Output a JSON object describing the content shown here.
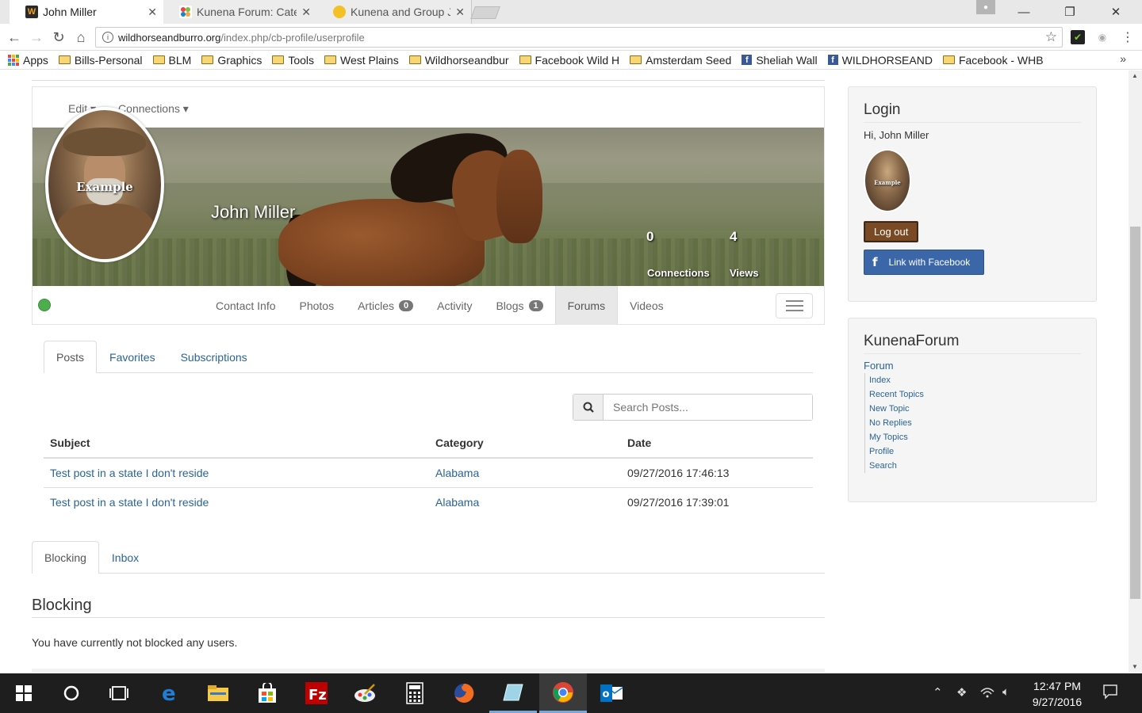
{
  "browser": {
    "tabs": [
      {
        "title": "John Miller",
        "favicon": "W",
        "favicon_bg": "#2a2a2a",
        "favicon_fg": "#f0a020",
        "active": true
      },
      {
        "title": "Kunena Forum: Cate",
        "favicon": "joomla-icon",
        "active": false
      },
      {
        "title": "Kunena and Group J",
        "favicon": "kunena-icon",
        "active": false
      }
    ],
    "url_host": "wildhorseandburro.org",
    "url_path": "/index.php/cb-profile/userprofile",
    "bookmarks": [
      {
        "label": "Apps",
        "type": "apps"
      },
      {
        "label": "Bills-Personal",
        "type": "folder"
      },
      {
        "label": "BLM",
        "type": "folder"
      },
      {
        "label": "Graphics",
        "type": "folder"
      },
      {
        "label": "Tools",
        "type": "folder"
      },
      {
        "label": "West Plains",
        "type": "folder"
      },
      {
        "label": "Wildhorseandbur",
        "type": "folder"
      },
      {
        "label": "Facebook Wild H",
        "type": "folder"
      },
      {
        "label": "Amsterdam Seed",
        "type": "folder"
      },
      {
        "label": "Sheliah Wall",
        "type": "facebook"
      },
      {
        "label": "WILDHORSEAND",
        "type": "facebook"
      },
      {
        "label": "Facebook - WHB",
        "type": "folder"
      }
    ],
    "bookmarks_more": "»"
  },
  "profile": {
    "menu": {
      "edit": "Edit",
      "connections": "Connections"
    },
    "name": "John Miller",
    "avatar_watermark": "Example",
    "stats": {
      "connections_count": "0",
      "connections_label": "Connections",
      "views_count": "4",
      "views_label": "Views"
    },
    "tabs": [
      {
        "label": "Contact Info"
      },
      {
        "label": "Photos"
      },
      {
        "label": "Articles",
        "badge": "0"
      },
      {
        "label": "Activity"
      },
      {
        "label": "Blogs",
        "badge": "1"
      },
      {
        "label": "Forums",
        "active": true
      },
      {
        "label": "Videos"
      }
    ],
    "online_status_color": "#4cae4c"
  },
  "forums": {
    "tabs": [
      {
        "label": "Posts",
        "active": true
      },
      {
        "label": "Favorites"
      },
      {
        "label": "Subscriptions"
      }
    ],
    "search_placeholder": "Search Posts...",
    "columns": [
      "Subject",
      "Category",
      "Date"
    ],
    "rows": [
      {
        "subject": "Test post in a state I don't reside",
        "category": "Alabama",
        "date": "09/27/2016 17:46:13"
      },
      {
        "subject": "Test post in a state I don't reside",
        "category": "Alabama",
        "date": "09/27/2016 17:39:01"
      }
    ]
  },
  "lower_tabs": [
    {
      "label": "Blocking",
      "active": true
    },
    {
      "label": "Inbox"
    }
  ],
  "blocking": {
    "title": "Blocking",
    "text": "You have currently not blocked any users."
  },
  "login_module": {
    "title": "Login",
    "greeting": "Hi, John Miller",
    "avatar_watermark": "Example",
    "logout_label": "Log out",
    "facebook_label": "Link with Facebook"
  },
  "kunena_module": {
    "title": "KunenaForum",
    "root": "Forum",
    "items": [
      "Index",
      "Recent Topics",
      "New Topic",
      "No Replies",
      "My Topics",
      "Profile",
      "Search"
    ]
  },
  "taskbar": {
    "time": "12:47 PM",
    "date": "9/27/2016",
    "apps": [
      "start-icon",
      "cortana-icon",
      "task-view-icon",
      "edge-icon",
      "file-explorer-icon",
      "store-icon",
      "filezilla-icon",
      "paint-icon",
      "calculator-icon",
      "firefox-icon",
      "notepad-icon",
      "chrome-icon",
      "outlook-icon"
    ]
  },
  "colors": {
    "link": "#2a6496",
    "logout_bg": "#7a4a24",
    "facebook_bg": "#3b67a8",
    "taskbar_bg": "#1e1e1e"
  }
}
